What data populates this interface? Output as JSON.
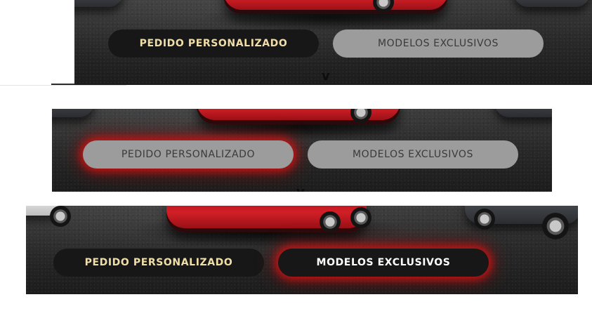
{
  "panels": [
    {
      "buttons": [
        {
          "label": "PEDIDO PERSONALIZADO",
          "state": "default"
        },
        {
          "label": "MODELOS EXCLUSIVOS",
          "state": "muted"
        }
      ],
      "indicator": "v"
    },
    {
      "buttons": [
        {
          "label": "PEDIDO PERSONALIZADO",
          "state": "hover-glow"
        },
        {
          "label": "MODELOS EXCLUSIVOS",
          "state": "muted"
        }
      ],
      "indicator": "v"
    },
    {
      "buttons": [
        {
          "label": "PEDIDO PERSONALIZADO",
          "state": "default"
        },
        {
          "label": "MODELOS EXCLUSIVOS",
          "state": "active-glow"
        }
      ]
    }
  ],
  "colors": {
    "accent_text": "#f1dfaa",
    "glow": "#d71414",
    "button_dark": "#171717",
    "button_muted": "#9c9c9c"
  },
  "icons": {
    "indicator": "chevron-down-icon"
  }
}
